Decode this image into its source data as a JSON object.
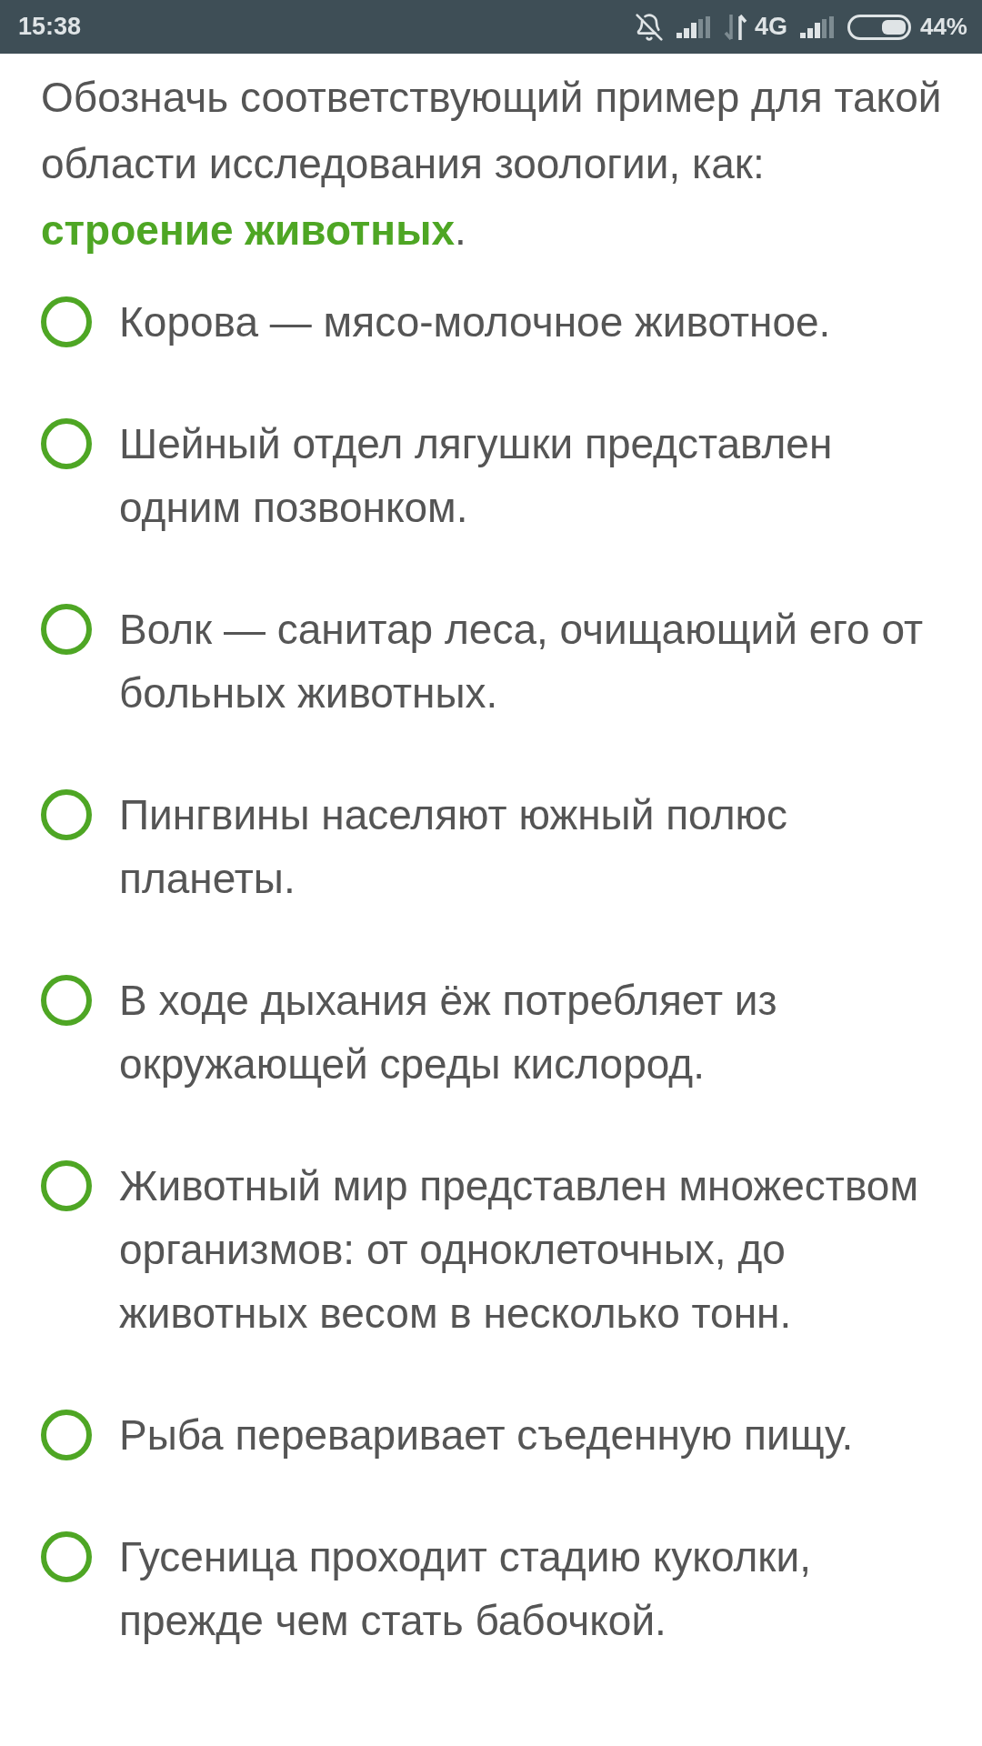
{
  "status_bar": {
    "time": "15:38",
    "network": "4G",
    "battery": "44%"
  },
  "question": {
    "text": "Обозначь соответствующий пример для такой области исследования зоологии, как:",
    "term": "строение животных",
    "tail": "."
  },
  "options": [
    {
      "label": "Корова — мясо-молочное животное.",
      "selected": false
    },
    {
      "label": "Шейный отдел лягушки представлен одним позвонком.",
      "selected": false
    },
    {
      "label": "Волк — санитар леса, очищающий его от больных животных.",
      "selected": false
    },
    {
      "label": "Пингвины населяют южный полюс планеты.",
      "selected": false
    },
    {
      "label": "В ходе дыхания ёж потребляет из окружающей среды кислород.",
      "selected": false
    },
    {
      "label": "Животный мир представлен множеством организмов: от одноклеточных, до животных весом в несколько тонн.",
      "selected": false
    },
    {
      "label": "Рыба переваривает съеденную пищу.",
      "selected": false
    },
    {
      "label": "Гусеница проходит стадию куколки, прежде чем стать бабочкой.",
      "selected": false
    }
  ]
}
